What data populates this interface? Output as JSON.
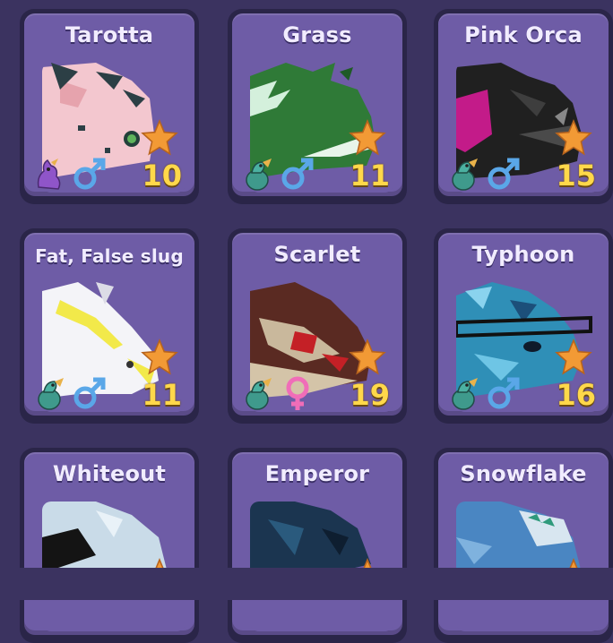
{
  "pets": [
    {
      "name": "Tarotta",
      "age": "10",
      "gender": "male",
      "egg": "dragon-purple"
    },
    {
      "name": "Grass",
      "age": "11",
      "gender": "male",
      "egg": "dragon-teal"
    },
    {
      "name": "Pink Orca",
      "age": "15",
      "gender": "male",
      "egg": "dragon-teal"
    },
    {
      "name": "Fat, False slug",
      "age": "11",
      "gender": "male",
      "egg": "dragon-teal"
    },
    {
      "name": "Scarlet",
      "age": "19",
      "gender": "female",
      "egg": "dragon-teal"
    },
    {
      "name": "Typhoon",
      "age": "16",
      "gender": "male",
      "egg": "dragon-teal"
    },
    {
      "name": "Whiteout",
      "age": "",
      "gender": "",
      "egg": ""
    },
    {
      "name": "Emperor",
      "age": "",
      "gender": "",
      "egg": ""
    },
    {
      "name": "Snowflake",
      "age": "",
      "gender": "",
      "egg": ""
    }
  ],
  "colors": {
    "star": "#f29a35",
    "age_text": "#ffd84a",
    "male": "#5aa7e8",
    "female": "#f06db8",
    "card": "#6e5ca6"
  }
}
